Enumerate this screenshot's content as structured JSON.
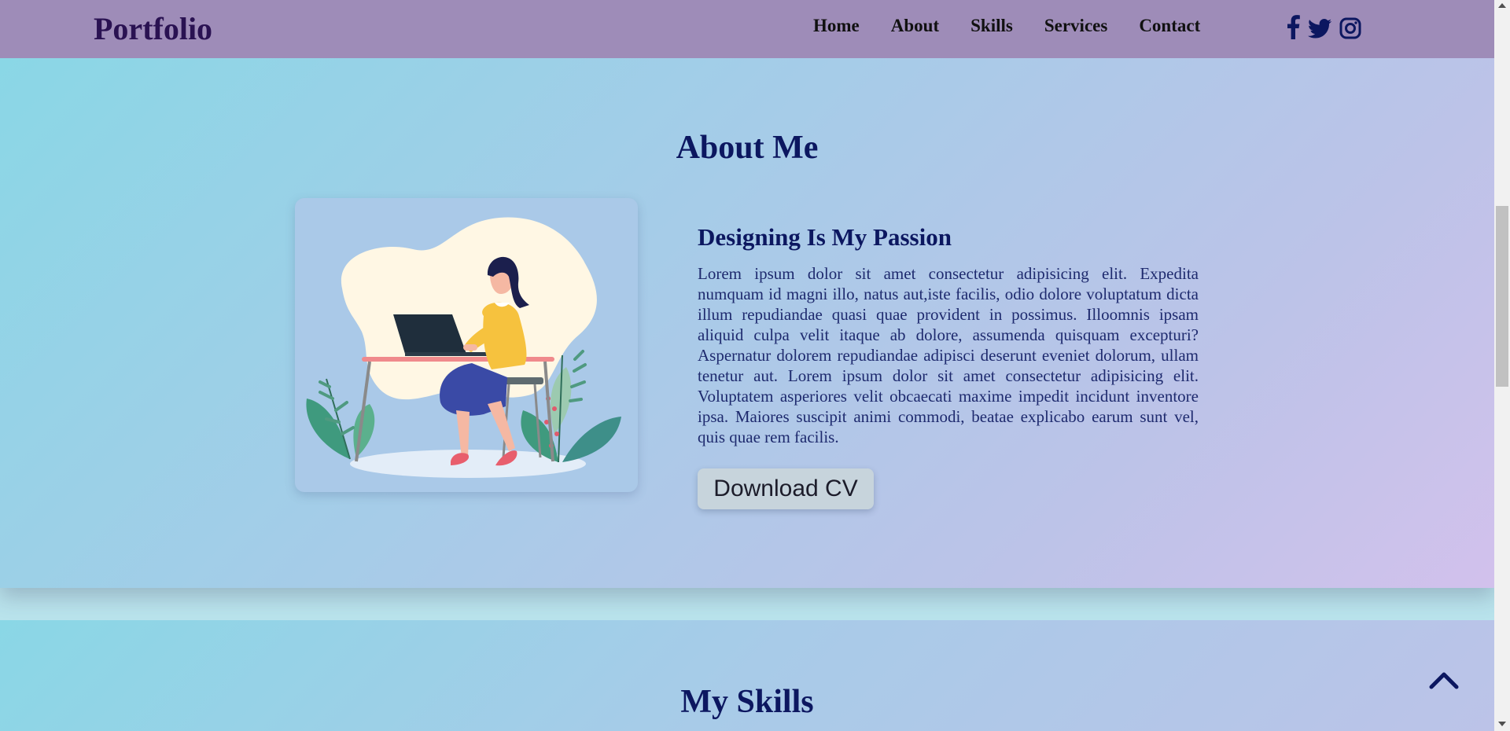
{
  "navbar": {
    "logo": "Portfolio",
    "links": [
      "Home",
      "About",
      "Skills",
      "Services",
      "Contact"
    ],
    "social_icons": [
      "facebook-icon",
      "twitter-icon",
      "instagram-icon"
    ]
  },
  "about": {
    "title": "About Me",
    "subtitle": "Designing Is My Passion",
    "paragraph": "Lorem ipsum dolor sit amet consectetur adipisicing elit. Expedita numquam id magni illo, natus aut,iste facilis, odio dolore voluptatum dicta illum repudiandae quasi quae provident in possimus. Illoomnis ipsam aliquid culpa velit itaque ab dolore, assumenda quisquam excepturi? Aspernatur dolorem repudiandae adipisci deserunt eveniet dolorum, ullam tenetur aut. Lorem ipsum dolor sit amet consectetur adipisicing elit. Voluptatem asperiores velit obcaecati maxime impedit incidunt inventore ipsa. Maiores suscipit animi commodi, beatae explicabo earum sunt vel, quis quae rem facilis.",
    "button_label": "Download CV"
  },
  "skills": {
    "title": "My Skills"
  },
  "colors": {
    "navbar_bg": "#9e8cb8",
    "heading": "#0c1760",
    "logo": "#2a1252"
  }
}
